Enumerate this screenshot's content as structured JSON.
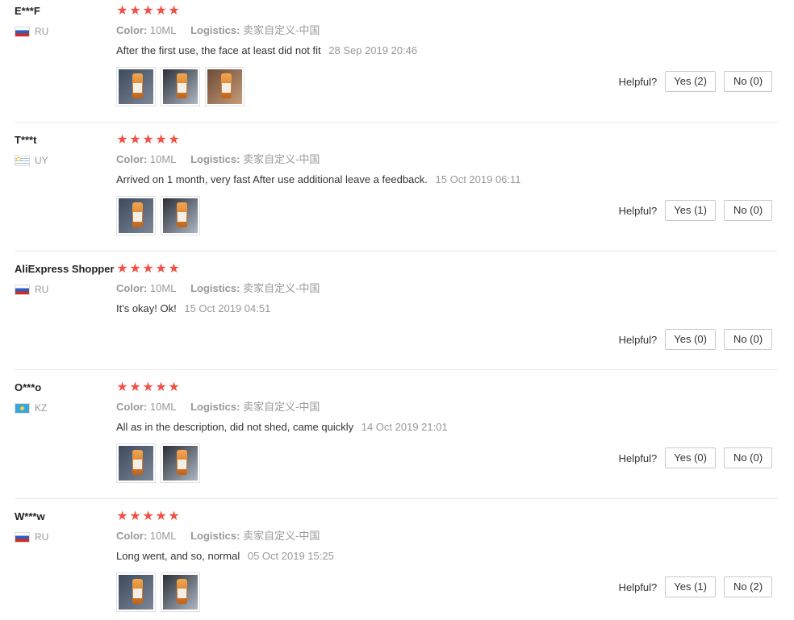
{
  "labels": {
    "color": "Color:",
    "logistics": "Logistics:",
    "helpful": "Helpful?"
  },
  "colors": {
    "star": "#f25045",
    "meta_grey": "#999999",
    "divider": "#e8e8e8"
  },
  "reviews": [
    {
      "user": "E***F",
      "country": "RU",
      "flag": "ru",
      "stars": 5,
      "color_value": "10ML",
      "logistics_value": "卖家自定义-中国",
      "text": "After the first use, the face at least did not fit",
      "date": "28 Sep 2019 20:46",
      "photos": 3,
      "yes": "Yes (2)",
      "no": "No (0)"
    },
    {
      "user": "T***t",
      "country": "UY",
      "flag": "uy",
      "stars": 5,
      "color_value": "10ML",
      "logistics_value": "卖家自定义-中国",
      "text": "Arrived on 1 month, very fast After use additional leave a feedback.",
      "date": "15 Oct 2019 06:11",
      "photos": 2,
      "yes": "Yes (1)",
      "no": "No (0)"
    },
    {
      "user": "AliExpress Shopper",
      "country": "RU",
      "flag": "ru",
      "stars": 5,
      "color_value": "10ML",
      "logistics_value": "卖家自定义-中国",
      "text": "It's okay! Ok!",
      "date": "15 Oct 2019 04:51",
      "photos": 0,
      "yes": "Yes (0)",
      "no": "No (0)"
    },
    {
      "user": "O***o",
      "country": "KZ",
      "flag": "kz",
      "stars": 5,
      "color_value": "10ML",
      "logistics_value": "卖家自定义-中国",
      "text": "All as in the description, did not shed, came quickly",
      "date": "14 Oct 2019 21:01",
      "photos": 2,
      "yes": "Yes (0)",
      "no": "No (0)"
    },
    {
      "user": "W***w",
      "country": "RU",
      "flag": "ru",
      "stars": 5,
      "color_value": "10ML",
      "logistics_value": "卖家自定义-中国",
      "text": "Long went, and so, normal",
      "date": "05 Oct 2019 15:25",
      "photos": 2,
      "yes": "Yes (1)",
      "no": "No (2)"
    }
  ]
}
